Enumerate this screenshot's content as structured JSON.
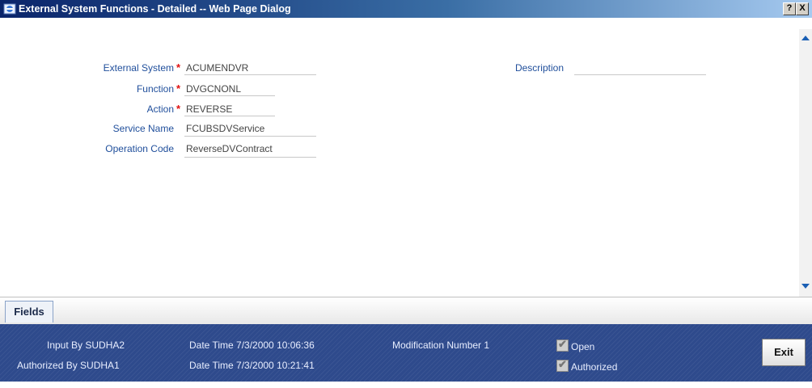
{
  "window": {
    "title": "External System Functions - Detailed -- Web Page Dialog",
    "help_label": "?",
    "close_label": "X"
  },
  "form": {
    "external_system": {
      "label": "External System",
      "value": "ACUMENDVR",
      "required_mark": "*"
    },
    "function": {
      "label": "Function",
      "value": "DVGCNONL",
      "required_mark": "*"
    },
    "action": {
      "label": "Action",
      "value": "REVERSE",
      "required_mark": "*"
    },
    "service_name": {
      "label": "Service Name",
      "value": "FCUBSDVService"
    },
    "operation_code": {
      "label": "Operation Code",
      "value": "ReverseDVContract"
    },
    "description": {
      "label": "Description",
      "value": ""
    }
  },
  "tabs": [
    {
      "label": "Fields",
      "active": true
    }
  ],
  "footer": {
    "input_by": "Input By SUDHA2",
    "authorized_by": "Authorized By SUDHA1",
    "date_time_input": "Date Time 7/3/2000 10:06:36",
    "date_time_auth": "Date Time 7/3/2000 10:21:41",
    "modification_number": "Modification Number 1",
    "open_label": "Open",
    "open_checked": true,
    "authorized_label": "Authorized",
    "authorized_checked": true,
    "exit_label": "Exit"
  },
  "colors": {
    "label_blue": "#1f4e9b",
    "required_red": "#e01010",
    "footer_bg": "#2e4a8c",
    "titlebar": "#0a246a"
  }
}
